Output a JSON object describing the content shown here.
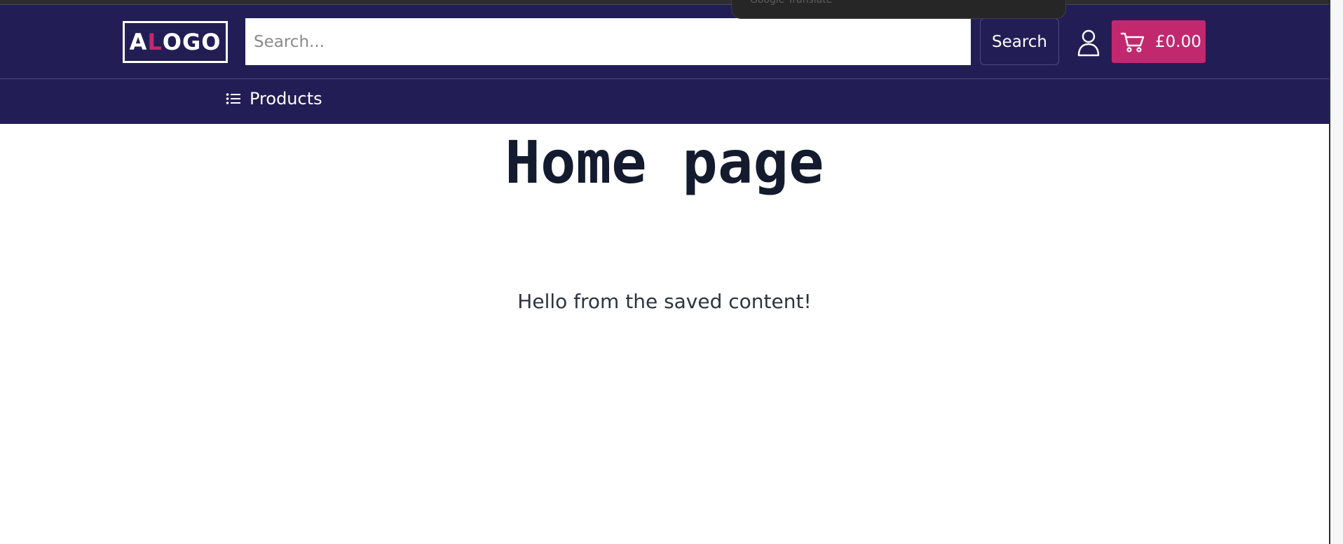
{
  "header": {
    "logo": {
      "first_letter": "A",
      "accent_letter": "L",
      "rest": "OGO"
    },
    "search": {
      "placeholder": "Search...",
      "button_label": "Search"
    },
    "cart": {
      "total": "£0.00"
    }
  },
  "translate_popup": {
    "label": "Google Translate"
  },
  "nav": {
    "products_label": "Products"
  },
  "main": {
    "title": "Home page",
    "body_text": "Hello from the saved content!"
  },
  "icons": {
    "account": "user-icon",
    "cart": "shopping-cart-icon",
    "products": "list-icon"
  },
  "colors": {
    "header_bg": "#221e55",
    "accent": "#c2286e",
    "title_text": "#141b2e"
  }
}
